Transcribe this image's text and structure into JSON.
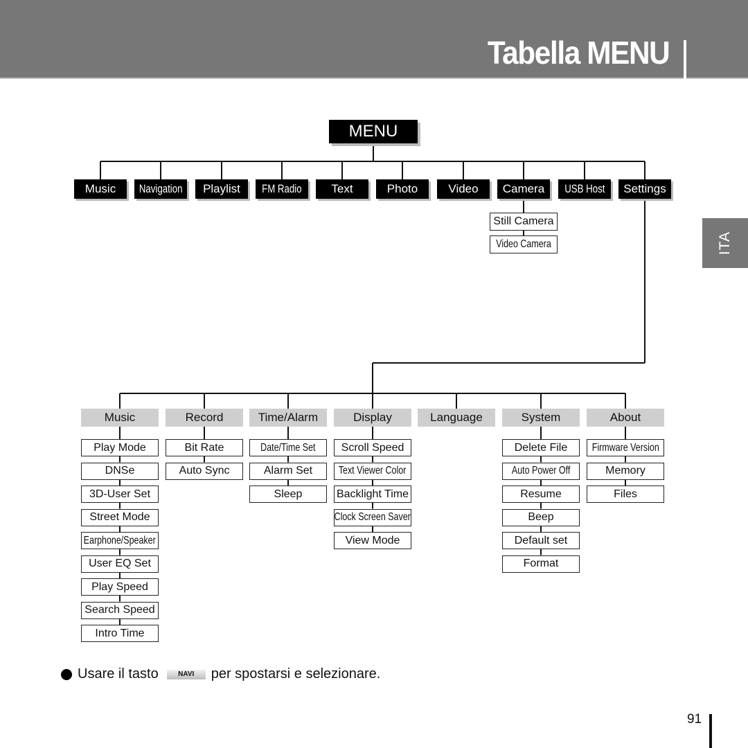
{
  "header": {
    "title": "Tabella MENU"
  },
  "language_tab": "ITA",
  "root": {
    "label": "MENU"
  },
  "top_menu": [
    {
      "label": "Music",
      "narrow": false
    },
    {
      "label": "Navigation",
      "narrow": true
    },
    {
      "label": "Playlist",
      "narrow": false
    },
    {
      "label": "FM Radio",
      "narrow": true
    },
    {
      "label": "Text",
      "narrow": false
    },
    {
      "label": "Photo",
      "narrow": false
    },
    {
      "label": "Video",
      "narrow": false
    },
    {
      "label": "Camera",
      "narrow": false
    },
    {
      "label": "USB Host",
      "narrow": true
    },
    {
      "label": "Settings",
      "narrow": false
    }
  ],
  "camera_submenu": [
    {
      "label": "Still Camera",
      "narrow": false
    },
    {
      "label": "Video Camera",
      "narrow": true
    }
  ],
  "settings_categories": [
    {
      "label": "Music",
      "items": [
        "Play Mode",
        "DNSe",
        "3D-User Set",
        "Street Mode",
        "Earphone/Speaker",
        "User EQ Set",
        "Play Speed",
        "Search Speed",
        "Intro Time"
      ],
      "narrow": [
        "Earphone/Speaker"
      ]
    },
    {
      "label": "Record",
      "items": [
        "Bit Rate",
        "Auto Sync"
      ],
      "narrow": []
    },
    {
      "label": "Time/Alarm",
      "items": [
        "Date/Time Set",
        "Alarm Set",
        "Sleep"
      ],
      "narrow": [
        "Date/Time Set"
      ]
    },
    {
      "label": "Display",
      "items": [
        "Scroll Speed",
        "Text Viewer Color",
        "Backlight Time",
        "Clock Screen Saver",
        "View Mode"
      ],
      "narrow": [
        "Text Viewer Color",
        "Clock Screen Saver"
      ]
    },
    {
      "label": "Language",
      "items": [],
      "narrow": []
    },
    {
      "label": "System",
      "items": [
        "Delete File",
        "Auto Power Off",
        "Resume",
        "Beep",
        "Default set",
        "Format"
      ],
      "narrow": [
        "Auto Power Off"
      ]
    },
    {
      "label": "About",
      "items": [
        "Firmware Version",
        "Memory",
        "Files"
      ],
      "narrow": [
        "Firmware Version"
      ]
    }
  ],
  "footer": {
    "note_before": "Usare il tasto",
    "navi_key": "NAVI",
    "note_after": "per spostarsi e selezionare.",
    "page_number": "91"
  }
}
